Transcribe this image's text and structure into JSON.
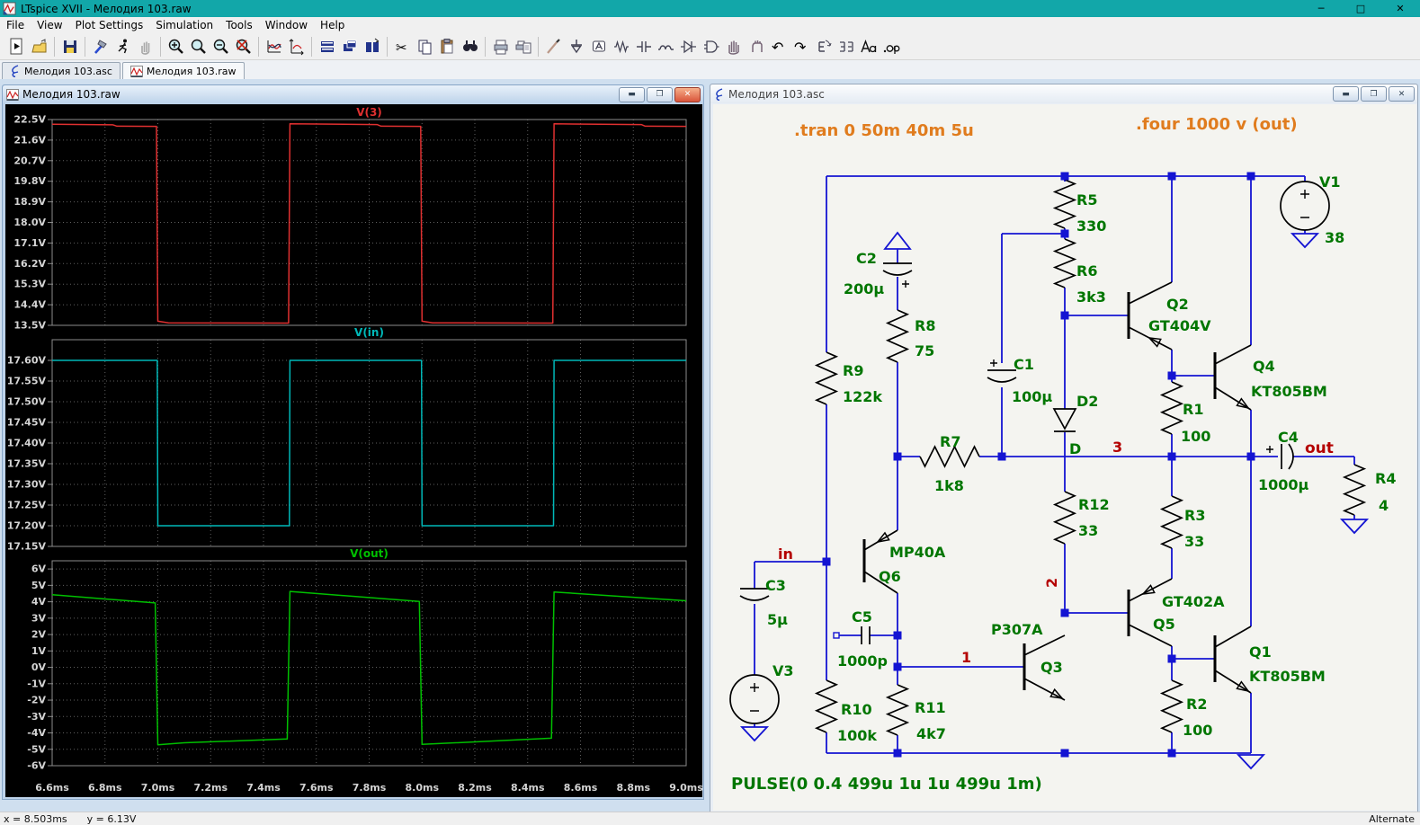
{
  "app": {
    "title": "LTspice XVII - Мелодия 103.raw",
    "menu": [
      "File",
      "View",
      "Plot Settings",
      "Simulation",
      "Tools",
      "Window",
      "Help"
    ],
    "tabs": [
      {
        "label": "Мелодия 103.asc"
      },
      {
        "label": "Мелодия 103.raw"
      }
    ],
    "status": {
      "cursor_x": "x = 8.503ms",
      "cursor_y": "y = 6.13V",
      "mode": "Alternate"
    }
  },
  "theme": {
    "titlebar": "#12a7a9",
    "wire": "#1414d2",
    "component_text": "#007600",
    "net_text": "#b40000",
    "directive_text": "#e07c1e"
  },
  "plot_window": {
    "title": "Мелодия 103.raw",
    "chart_data": {
      "type": "line",
      "x": {
        "unit": "ms",
        "min": 6.6,
        "max": 9.0,
        "tick_step": 0.2,
        "tick_labels": [
          "6.6ms",
          "6.8ms",
          "7.0ms",
          "7.2ms",
          "7.4ms",
          "7.6ms",
          "7.8ms",
          "8.0ms",
          "8.2ms",
          "8.4ms",
          "8.6ms",
          "8.8ms",
          "9.0ms"
        ]
      },
      "panes": [
        {
          "name": "V(3)",
          "color": "#e03030",
          "y_edge_min": 13.5,
          "y_edge_max": 22.5,
          "tick_start": 22.5,
          "tick_step": 0.9,
          "tick_labels": [
            "22.5V",
            "21.6V",
            "20.7V",
            "19.8V",
            "18.9V",
            "18.0V",
            "17.1V",
            "16.2V",
            "15.3V",
            "14.4V",
            "13.5V"
          ],
          "points": [
            [
              6.6,
              22.29
            ],
            [
              6.83,
              22.27
            ],
            [
              6.845,
              22.21
            ],
            [
              6.995,
              22.2
            ],
            [
              7.0,
              13.68
            ],
            [
              7.04,
              13.61
            ],
            [
              7.495,
              13.6
            ],
            [
              7.5,
              22.31
            ],
            [
              7.83,
              22.28
            ],
            [
              7.845,
              22.21
            ],
            [
              7.995,
              22.2
            ],
            [
              8.0,
              13.68
            ],
            [
              8.04,
              13.61
            ],
            [
              8.495,
              13.6
            ],
            [
              8.5,
              22.31
            ],
            [
              8.83,
              22.28
            ],
            [
              8.845,
              22.21
            ],
            [
              9.0,
              22.2
            ]
          ]
        },
        {
          "name": "V(in)",
          "color": "#00b8b8",
          "y_edge_min": 17.15,
          "y_edge_max": 17.65,
          "tick_start": 17.6,
          "tick_step": 0.05,
          "tick_labels": [
            "17.60V",
            "17.55V",
            "17.50V",
            "17.45V",
            "17.40V",
            "17.35V",
            "17.30V",
            "17.25V",
            "17.20V",
            "17.15V"
          ],
          "points": [
            [
              6.6,
              17.6
            ],
            [
              6.998,
              17.6
            ],
            [
              7.0,
              17.2
            ],
            [
              7.498,
              17.2
            ],
            [
              7.5,
              17.6
            ],
            [
              7.998,
              17.6
            ],
            [
              8.0,
              17.2
            ],
            [
              8.498,
              17.2
            ],
            [
              8.5,
              17.6
            ],
            [
              9.0,
              17.6
            ]
          ]
        },
        {
          "name": "V(out)",
          "color": "#00c000",
          "y_edge_min": -6,
          "y_edge_max": 6.5,
          "tick_start": 6,
          "tick_step": 1,
          "tick_labels": [
            "6V",
            "5V",
            "4V",
            "3V",
            "2V",
            "1V",
            "0V",
            "-1V",
            "-2V",
            "-3V",
            "-4V",
            "-5V",
            "-6V"
          ],
          "points": [
            [
              6.6,
              4.43
            ],
            [
              6.99,
              3.93
            ],
            [
              7.0,
              -4.73
            ],
            [
              7.1,
              -4.6
            ],
            [
              7.49,
              -4.37
            ],
            [
              7.5,
              4.63
            ],
            [
              7.99,
              4.02
            ],
            [
              8.0,
              -4.7
            ],
            [
              8.49,
              -4.32
            ],
            [
              8.5,
              4.6
            ],
            [
              9.0,
              4.06
            ]
          ]
        }
      ]
    }
  },
  "schematic_window": {
    "title": "Мелодия 103.asc",
    "directives": {
      "tran": ".tran 0 50m 40m 5u",
      "four": ".four 1000 v (out)",
      "pulse": "PULSE(0 0.4 499u 1u 1u 499u 1m)"
    },
    "nets": {
      "in": "in",
      "out": "out",
      "n1": "1",
      "n2": "2",
      "n3": "3"
    },
    "parts": {
      "r1": {
        "ref": "R1",
        "val": "100"
      },
      "r2": {
        "ref": "R2",
        "val": "100"
      },
      "r3": {
        "ref": "R3",
        "val": "33"
      },
      "r4": {
        "ref": "R4",
        "val": "4"
      },
      "r5": {
        "ref": "R5",
        "val": "330"
      },
      "r6": {
        "ref": "R6",
        "val": "3k3"
      },
      "r7": {
        "ref": "R7",
        "val": "1k8"
      },
      "r8": {
        "ref": "R8",
        "val": "75"
      },
      "r9": {
        "ref": "R9",
        "val": "122k"
      },
      "r10": {
        "ref": "R10",
        "val": "100k"
      },
      "r11": {
        "ref": "R11",
        "val": "4k7"
      },
      "r12": {
        "ref": "R12",
        "val": "33"
      },
      "c1": {
        "ref": "C1",
        "val": "100µ"
      },
      "c2": {
        "ref": "C2",
        "val": "200µ"
      },
      "c3": {
        "ref": "C3",
        "val": "5µ"
      },
      "c4": {
        "ref": "C4",
        "val": "1000µ"
      },
      "c5": {
        "ref": "C5",
        "val": "1000p"
      },
      "d2": {
        "ref": "D2",
        "val": "D"
      },
      "q1": {
        "ref": "Q1",
        "val": "KT805BM"
      },
      "q2": {
        "ref": "Q2",
        "val": "GT404V"
      },
      "q3": {
        "ref": "Q3",
        "val": "P307A"
      },
      "q4": {
        "ref": "Q4",
        "val": "KT805BM"
      },
      "q5": {
        "ref": "Q5",
        "val": "GT402A"
      },
      "q6": {
        "ref": "Q6",
        "val": "MP40A"
      },
      "v1": {
        "ref": "V1",
        "val": "38"
      },
      "v3": {
        "ref": "V3"
      }
    }
  }
}
